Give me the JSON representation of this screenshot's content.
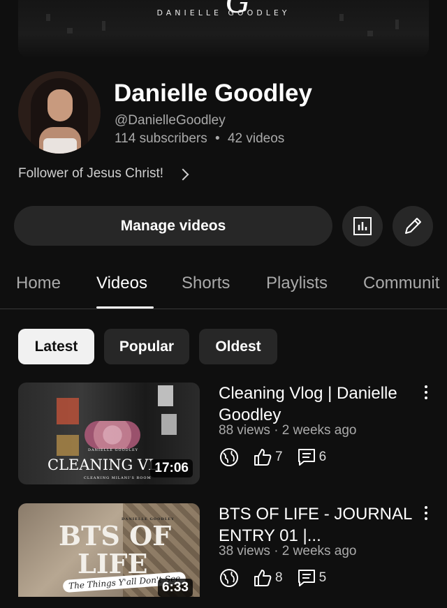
{
  "banner": {
    "brand_text": "DANIELLE GOODLEY",
    "script": "G"
  },
  "channel": {
    "name": "Danielle Goodley",
    "handle": "@DanielleGoodley",
    "subscribers": "114 subscribers",
    "separator": "•",
    "videos": "42 videos",
    "about": "Follower of Jesus Christ!"
  },
  "buttons": {
    "manage": "Manage videos",
    "analytics_icon": "analytics-icon",
    "edit_icon": "pencil-icon"
  },
  "tabs": [
    "Home",
    "Videos",
    "Shorts",
    "Playlists",
    "Communit"
  ],
  "active_tab": "Videos",
  "filters": [
    "Latest",
    "Popular",
    "Oldest"
  ],
  "active_filter": "Latest",
  "videos": [
    {
      "title": "Cleaning Vlog | Danielle Goodley",
      "meta": "88 views · 2 weeks ago",
      "duration": "17:06",
      "likes": "7",
      "comments": "6",
      "thumb_brand": "DANIELLE GOODLEY",
      "thumb_title": "CLEANING VL",
      "thumb_sub": "CLEANING MILANI'S ROOM"
    },
    {
      "title": "BTS OF LIFE - JOURNAL ENTRY 01 |...",
      "meta": "38 views · 2 weeks ago",
      "duration": "6:33",
      "likes": "8",
      "comments": "5",
      "thumb_brand": "DANIELLE GOODLEY",
      "thumb_title": "BTS OF",
      "thumb_title2": "LIFE",
      "thumb_sub": "The Things Y'all Don't See"
    }
  ]
}
